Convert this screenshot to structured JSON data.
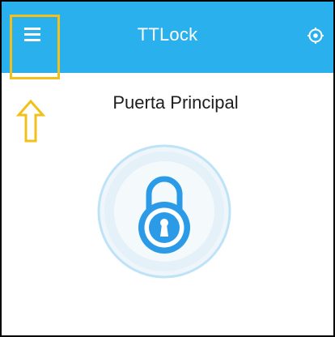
{
  "app_bar": {
    "title": "TTLock",
    "menu_icon": "hamburger-menu-icon",
    "settings_icon": "target-settings-icon",
    "background_color": "#2ab0ec"
  },
  "lock": {
    "name": "Puerta Principal",
    "icon": "padlock-icon",
    "accent_color": "#2b9be8"
  },
  "annotation": {
    "highlight_color": "#f2c01a",
    "arrow_icon": "up-arrow-icon"
  }
}
